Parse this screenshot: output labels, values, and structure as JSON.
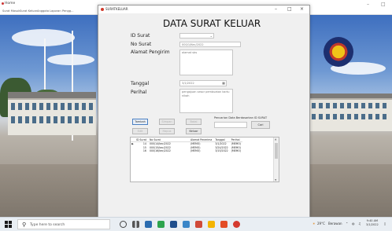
{
  "background_window": {
    "title": "Home",
    "menu": [
      "Surat Masuk",
      "Surat Keluar",
      "Anggota",
      "Laporan",
      "Pengg..."
    ]
  },
  "dialog": {
    "title": "SURATKELUAR",
    "heading": "DATA SURAT KELUAR",
    "labels": {
      "id_surat": "ID Surat",
      "no_surat": "No Surat",
      "alamat_pengirim": "Alamat Pengirim",
      "tanggal": "Tanggal",
      "perihal": "Perihal"
    },
    "fields": {
      "id_surat": "",
      "no_surat": "000/1/Kec/2022",
      "alamat_pengirim": "alamat sbs",
      "tanggal": "3/1/2022",
      "perihal": "pengajuan sesor pembuatan kartu nikah"
    },
    "buttons": {
      "tambah": "Tambah",
      "simpan": "Simpan",
      "batal": "Batal",
      "edit": "Edit",
      "hapus": "Hapus",
      "keluar": "Keluar",
      "cari": "Cari"
    },
    "search": {
      "label": "Pencarian Data Berdasarkan ID SURAT",
      "value": ""
    },
    "table": {
      "headers": [
        "ID Surat",
        "No Surat",
        "Alamat Penerima",
        "Tanggal",
        "Perihal"
      ],
      "rows": [
        [
          "14",
          "000/14/kec/2022",
          "(MEMO)",
          "3/1/2022",
          "(MEMO)"
        ],
        [
          "15",
          "000/15/kec/2022",
          "(MEMO)",
          "3/24/2022",
          "(MEMO)"
        ],
        [
          "16",
          "000/16/kec/2022",
          "(MEMO)",
          "3/15/2022",
          "(MEMO)"
        ]
      ]
    }
  },
  "taskbar": {
    "search_placeholder": "Type here to search",
    "weather": "29°C",
    "weather_desc": "Berawan",
    "time": "9:40 AM",
    "date": "3/1/2022"
  },
  "colors": {
    "accent": "#4b7fc1",
    "title_icon": "#d0392b"
  }
}
